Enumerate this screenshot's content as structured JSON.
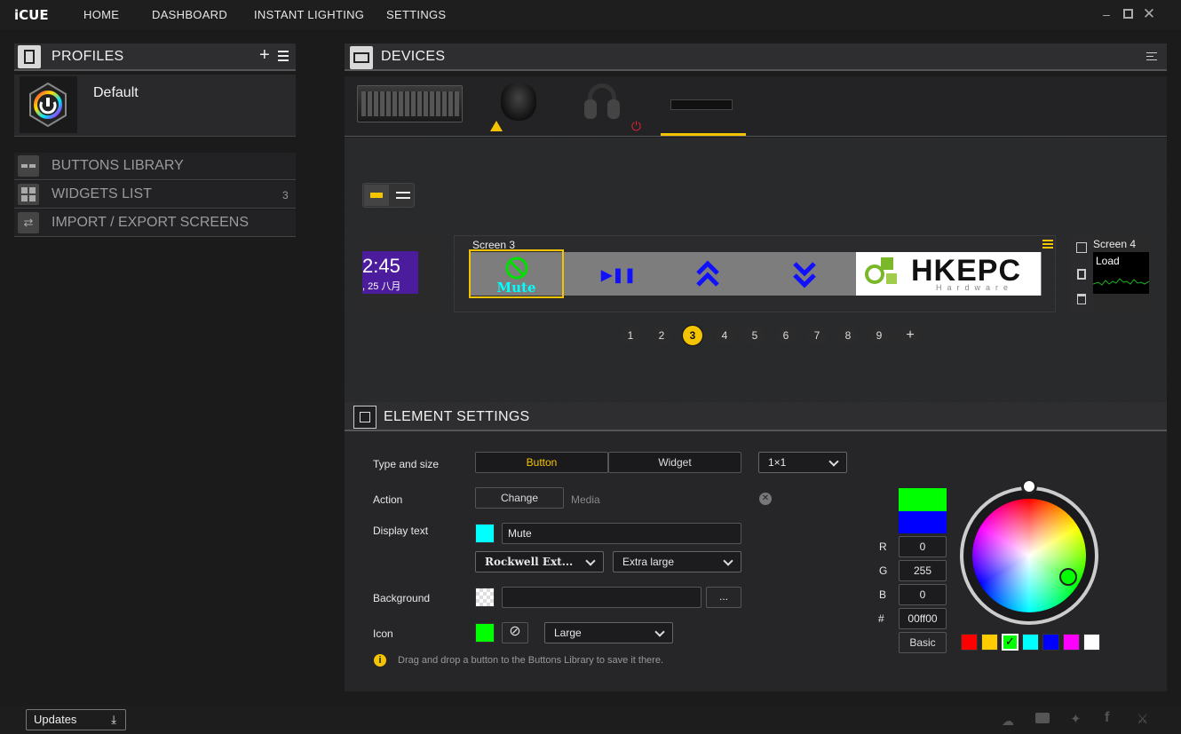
{
  "app": {
    "logo": "iCUE",
    "nav": [
      "HOME",
      "DASHBOARD",
      "INSTANT LIGHTING",
      "SETTINGS"
    ]
  },
  "profiles": {
    "title": "PROFILES",
    "items": [
      {
        "name": "Default"
      }
    ]
  },
  "library": [
    {
      "label": "BUTTONS LIBRARY",
      "count": ""
    },
    {
      "label": "WIDGETS LIST",
      "count": "3"
    },
    {
      "label": "IMPORT / EXPORT SCREENS",
      "count": ""
    }
  ],
  "devices": {
    "title": "DEVICES"
  },
  "screens": {
    "prev_time": "2:45",
    "prev_date": ", 25 八月",
    "current_label": "Screen 3",
    "next_label": "Screen 4",
    "next_widget": "Load",
    "mute_label": "Mute",
    "logo_text": "HKEPC",
    "logo_sub": "Hardware",
    "pages": [
      "1",
      "2",
      "3",
      "4",
      "5",
      "6",
      "7",
      "8",
      "9"
    ],
    "active_page": "3"
  },
  "element_settings": {
    "title": "ELEMENT SETTINGS",
    "type_label": "Type and size",
    "type_button": "Button",
    "type_widget": "Widget",
    "size": "1×1",
    "action_label": "Action",
    "change": "Change",
    "action_value": "Media",
    "display_label": "Display text",
    "display_value": "Mute",
    "text_color": "#00ffff",
    "font": "Rockwell Ext...",
    "font_size": "Extra large",
    "bg_label": "Background",
    "bg_value": "",
    "bg_browse": "...",
    "icon_label": "Icon",
    "icon_color": "#00ff00",
    "icon_size": "Large",
    "hint": "Drag and drop a button to the Buttons Library to save it there.",
    "color": {
      "r_label": "R",
      "g_label": "G",
      "b_label": "B",
      "hex_label": "#",
      "r": "0",
      "g": "255",
      "b": "0",
      "hex": "00ff00",
      "basic": "Basic",
      "new": "#00ff00",
      "old": "#0000ff"
    },
    "presets": [
      "#ff0000",
      "#ffcc00",
      "#00ff00",
      "#00ffff",
      "#0000ff",
      "#ff00ff",
      "#ffffff"
    ]
  },
  "footer": {
    "updates": "Updates"
  }
}
